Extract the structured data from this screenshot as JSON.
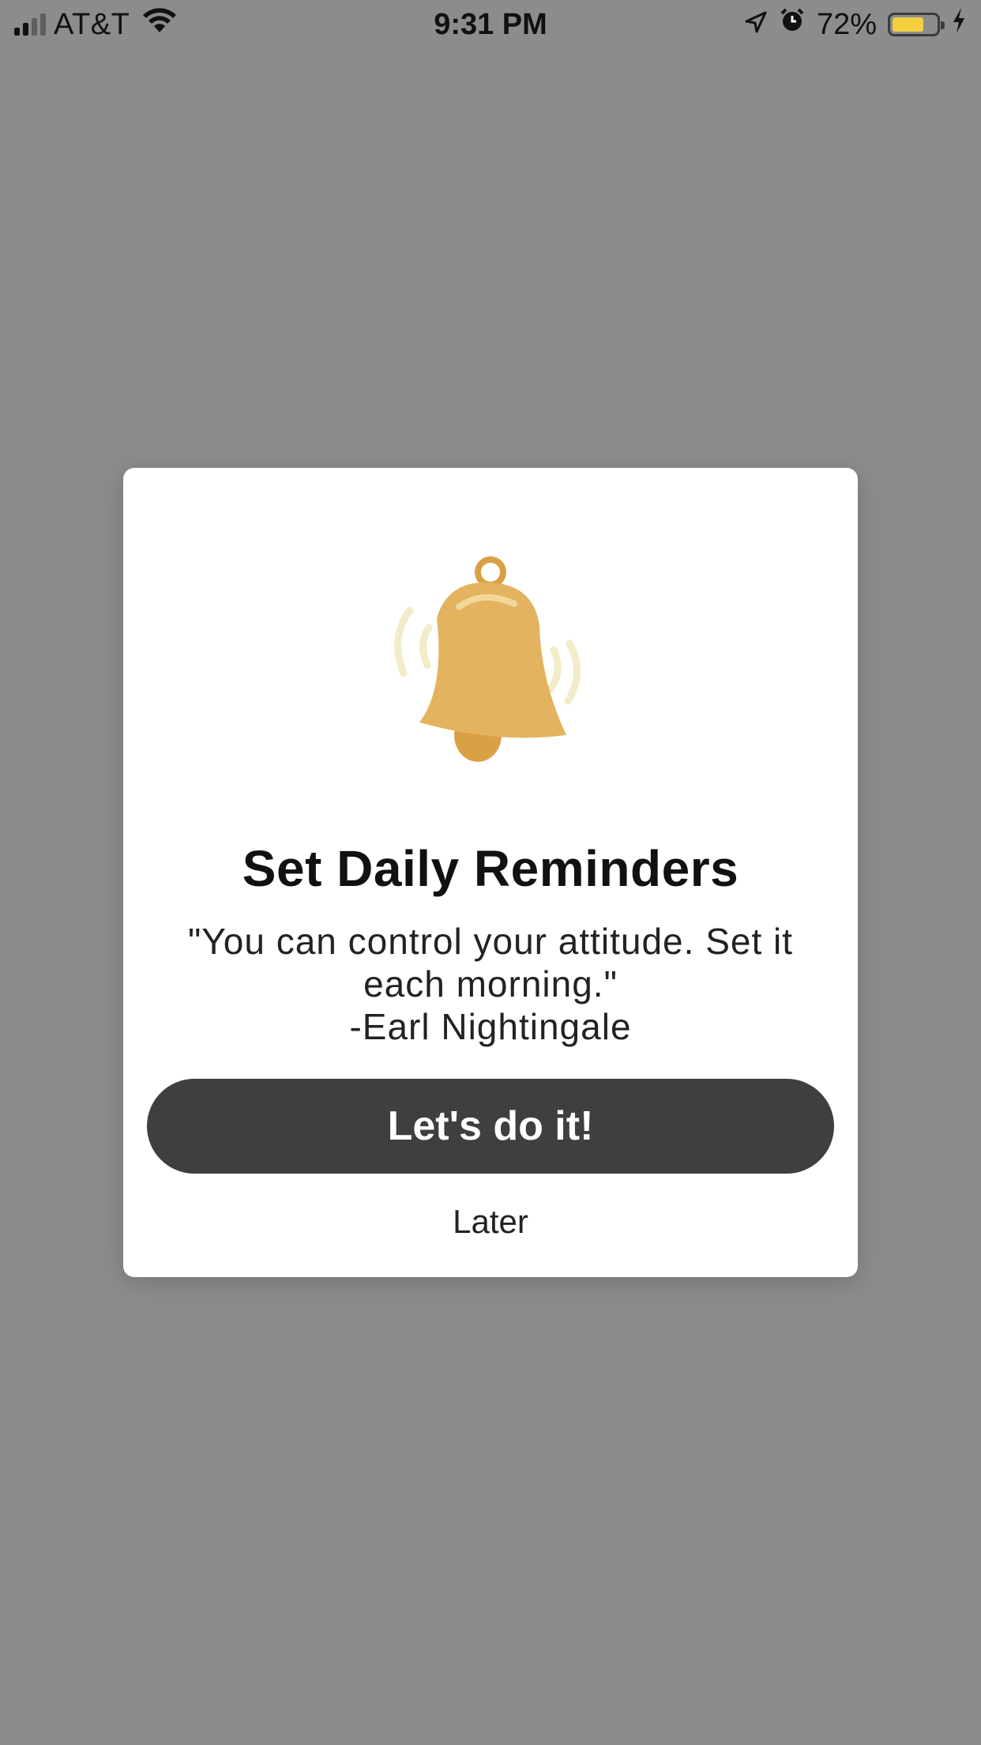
{
  "status_bar": {
    "carrier": "AT&T",
    "time": "9:31 PM",
    "battery_percent": "72%",
    "battery_level": 0.72,
    "battery_color": "#f4d03f",
    "icons": [
      "signal-icon",
      "wifi-icon",
      "location-icon",
      "alarm-icon",
      "battery-icon",
      "charging-bolt-icon"
    ]
  },
  "modal": {
    "icon": "bell-icon",
    "title": "Set Daily Reminders",
    "quote_line1": "\"You can control your attitude. Set it",
    "quote_line2": "each morning.\"",
    "quote_author": "-Earl Nightingale",
    "primary_button": "Let's do it!",
    "secondary_button": "Later"
  },
  "colors": {
    "backdrop": "#8b8c8e",
    "modal_bg": "#ffffff",
    "button_bg": "#3e3f41",
    "bell": "#e3b35f"
  }
}
